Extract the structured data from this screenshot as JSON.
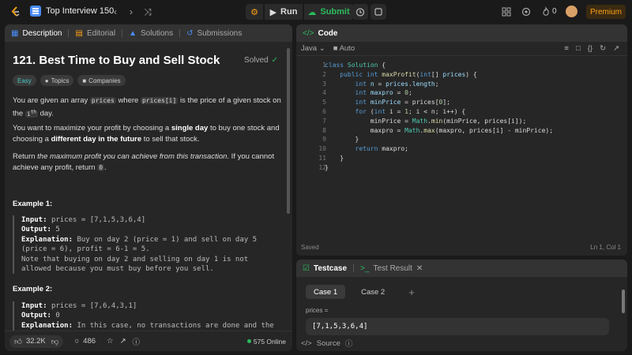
{
  "topbar": {
    "problem_list": "Top Interview 150",
    "run_label": "Run",
    "submit_label": "Submit",
    "streak": "0",
    "premium": "Premium"
  },
  "description": {
    "tabs": [
      {
        "label": "Description"
      },
      {
        "label": "Editorial"
      },
      {
        "label": "Solutions"
      },
      {
        "label": "Submissions"
      }
    ],
    "title": "121. Best Time to Buy and Sell Stock",
    "status": "Solved",
    "tags": [
      "Easy",
      "Topics",
      "Companies"
    ],
    "p1a": "You are given an array",
    "p1code1": "prices",
    "p1b": "where",
    "p1code2": "prices[i]",
    "p1c": "is the price of a given stock on the",
    "p1d": "i",
    "p1sup": "th",
    "p1e": "day.",
    "p2a": "You want to maximize your profit by choosing a",
    "p2b": "single day",
    "p2c": "to buy one stock and choosing a",
    "p2d": "different day in the future",
    "p2e": "to sell that stock.",
    "p3a": "Return",
    "p3b": "the maximum profit you can achieve from this transaction",
    "p3c": ". If you cannot achieve any profit, return",
    "p3code": "0",
    "p3d": ".",
    "ex1_title": "Example 1:",
    "ex1_input_label": "Input:",
    "ex1_input": "prices = [7,1,5,3,6,4]",
    "ex1_output_label": "Output:",
    "ex1_output": "5",
    "ex1_expl_label": "Explanation:",
    "ex1_expl": "Buy on day 2 (price = 1) and sell on day 5 (price = 6), profit = 6-1 = 5.",
    "ex1_note": "Note that buying on day 2 and selling on day 1 is not allowed because you must buy before you sell.",
    "ex2_title": "Example 2:",
    "ex2_input_label": "Input:",
    "ex2_input": "prices = [7,6,4,3,1]",
    "ex2_output_label": "Output:",
    "ex2_output": "0",
    "ex2_expl_label": "Explanation:",
    "ex2_expl": "In this case, no transactions are done and the",
    "likes": "32.2K",
    "comments": "486",
    "online": "575 Online"
  },
  "code": {
    "tab": "Code",
    "language": "Java",
    "mode": "Auto",
    "line_numbers": [
      "1",
      "2",
      "3",
      "4",
      "5",
      "6",
      "7",
      "8",
      "9",
      "10",
      "11",
      "12"
    ],
    "status": "Saved",
    "cursor": "Ln 1, Col 1"
  },
  "testcase": {
    "tab1": "Testcase",
    "tab2": "Test Result",
    "cases": [
      "Case 1",
      "Case 2"
    ],
    "param_label": "prices =",
    "param_value": "[7,1,5,3,6,4]",
    "source": "Source"
  }
}
